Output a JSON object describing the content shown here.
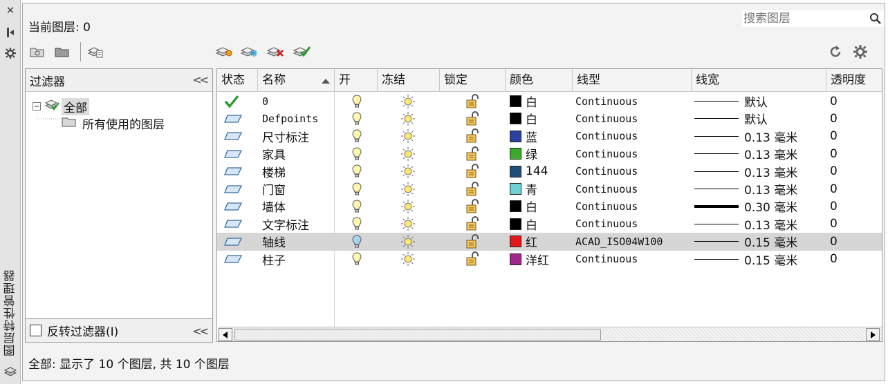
{
  "side": {
    "title": "图层特性管理器",
    "icons": [
      "close-icon",
      "pin-icon",
      "settings-icon",
      "layers-icon"
    ]
  },
  "header": {
    "current_layer_label": "当前图层: 0",
    "search_placeholder": "搜索图层"
  },
  "filters": {
    "title": "过滤器",
    "tree": [
      {
        "label": "全部"
      },
      {
        "label": "所有使用的图层"
      }
    ],
    "invert_label": "反转过滤器(I)"
  },
  "columns": [
    "状态",
    "名称",
    "开",
    "冻结",
    "锁定",
    "颜色",
    "线型",
    "线宽",
    "透明度"
  ],
  "layers": [
    {
      "name": "0",
      "current": true,
      "color_hex": "#000000",
      "color_name": "白",
      "linetype": "Continuous",
      "lineweight": "默认",
      "thick": false,
      "transparency": "0",
      "selected": false,
      "mono_name": true
    },
    {
      "name": "Defpoints",
      "current": false,
      "color_hex": "#000000",
      "color_name": "白",
      "linetype": "Continuous",
      "lineweight": "默认",
      "thick": false,
      "transparency": "0",
      "selected": false,
      "mono_name": true
    },
    {
      "name": "尺寸标注",
      "current": false,
      "color_hex": "#2a3fa0",
      "color_name": "蓝",
      "linetype": "Continuous",
      "lineweight": "0.13 毫米",
      "thick": false,
      "transparency": "0",
      "selected": false
    },
    {
      "name": "家具",
      "current": false,
      "color_hex": "#3caa2c",
      "color_name": "绿",
      "linetype": "Continuous",
      "lineweight": "0.13 毫米",
      "thick": false,
      "transparency": "0",
      "selected": false
    },
    {
      "name": "楼梯",
      "current": false,
      "color_hex": "#1e4f78",
      "color_name": "144",
      "linetype": "Continuous",
      "lineweight": "0.13 毫米",
      "thick": false,
      "transparency": "0",
      "selected": false
    },
    {
      "name": "门窗",
      "current": false,
      "color_hex": "#6fd0d6",
      "color_name": "青",
      "linetype": "Continuous",
      "lineweight": "0.13 毫米",
      "thick": false,
      "transparency": "0",
      "selected": false
    },
    {
      "name": "墙体",
      "current": false,
      "color_hex": "#000000",
      "color_name": "白",
      "linetype": "Continuous",
      "lineweight": "0.30 毫米",
      "thick": true,
      "transparency": "0",
      "selected": false
    },
    {
      "name": "文字标注",
      "current": false,
      "color_hex": "#000000",
      "color_name": "白",
      "linetype": "Continuous",
      "lineweight": "0.13 毫米",
      "thick": false,
      "transparency": "0",
      "selected": false
    },
    {
      "name": "轴线",
      "current": false,
      "color_hex": "#e01818",
      "color_name": "红",
      "linetype": "ACAD_ISO04W100",
      "lineweight": "0.15 毫米",
      "thick": false,
      "transparency": "0",
      "selected": true
    },
    {
      "name": "柱子",
      "current": false,
      "color_hex": "#a0288c",
      "color_name": "洋红",
      "linetype": "Continuous",
      "lineweight": "0.15 毫米",
      "thick": false,
      "transparency": "0",
      "selected": false
    }
  ],
  "status": "全部: 显示了 10 个图层, 共 10 个图层"
}
